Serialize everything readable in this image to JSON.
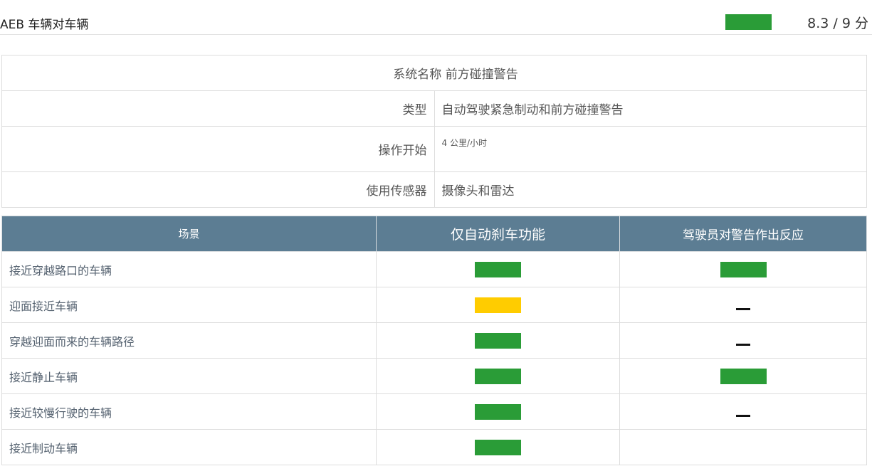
{
  "header": {
    "title": "AEB 车辆对车辆",
    "score": "8.3 / 9 分",
    "badge_color": "#2a9c37"
  },
  "info": {
    "system_label": "系统名称",
    "system_value": "前方碰撞警告",
    "type_label": "类型",
    "type_value": "自动驾驶紧急制动和前方碰撞警告",
    "operation_label": "操作开始",
    "operation_value": "4 公里/小时",
    "sensors_label": "使用传感器",
    "sensors_value": "摄像头和雷达"
  },
  "scenarios": {
    "headers": {
      "scenario": "场景",
      "auto_brake": "仅自动刹车功能",
      "driver_reaction": "驾驶员对警告作出反应"
    },
    "rows": [
      {
        "label": "接近穿越路口的车辆",
        "auto_brake": "green",
        "driver_reaction": "green"
      },
      {
        "label": "迎面接近车辆",
        "auto_brake": "yellow",
        "driver_reaction": "dash"
      },
      {
        "label": "穿越迎面而来的车辆路径",
        "auto_brake": "green",
        "driver_reaction": "dash"
      },
      {
        "label": "接近静止车辆",
        "auto_brake": "green",
        "driver_reaction": "green"
      },
      {
        "label": "接近较慢行驶的车辆",
        "auto_brake": "green",
        "driver_reaction": "dash"
      },
      {
        "label": "接近制动车辆",
        "auto_brake": "green",
        "driver_reaction": "none"
      }
    ]
  },
  "colors": {
    "green": "#2a9c37",
    "yellow": "#ffcc00",
    "header_bg": "#5c7d93"
  }
}
